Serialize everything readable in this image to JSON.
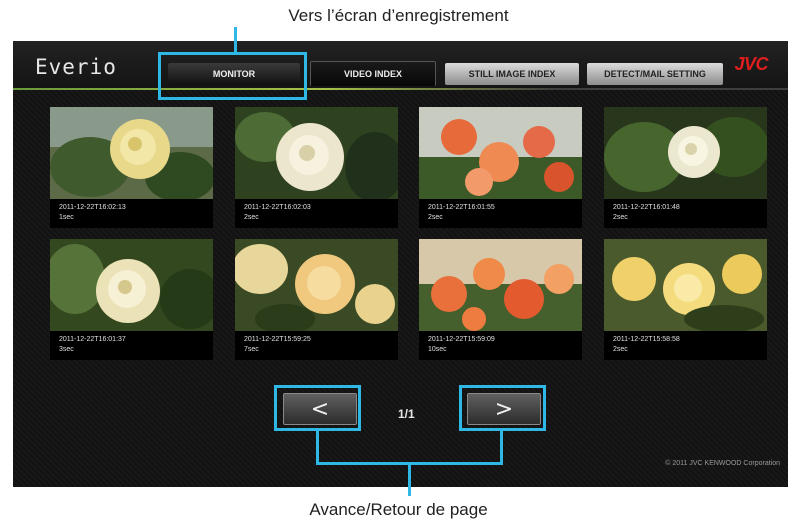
{
  "annotations": {
    "top": "Vers l’écran d’enregistrement",
    "bottom": "Avance/Retour de page"
  },
  "app": {
    "logo": "Everio",
    "brand": "JVC"
  },
  "tabs": [
    {
      "label": "MONITOR"
    },
    {
      "label": "VIDEO INDEX"
    },
    {
      "label": "STILL IMAGE INDEX"
    },
    {
      "label": "DETECT/MAIL SETTING"
    }
  ],
  "videos": [
    {
      "timestamp": "2011-12-22T16:02:13",
      "duration": "1sec"
    },
    {
      "timestamp": "2011-12-22T16:02:03",
      "duration": "2sec"
    },
    {
      "timestamp": "2011-12-22T16:01:55",
      "duration": "2sec"
    },
    {
      "timestamp": "2011-12-22T16:01:48",
      "duration": "2sec"
    },
    {
      "timestamp": "2011-12-22T16:01:37",
      "duration": "3sec"
    },
    {
      "timestamp": "2011-12-22T15:59:25",
      "duration": "7sec"
    },
    {
      "timestamp": "2011-12-22T15:59:09",
      "duration": "10sec"
    },
    {
      "timestamp": "2011-12-22T15:58:58",
      "duration": "2sec"
    }
  ],
  "pagination": {
    "prev_label": "<",
    "next_label": ">",
    "indicator": "1/1"
  },
  "footer": {
    "copyright": "© 2011 JVC KENWOOD Corporation"
  },
  "colors": {
    "highlight": "#2eb8e6",
    "brand": "#e01e1e",
    "accent_line": "#a6c24a"
  },
  "icons": {
    "prev": "chevron-left-icon",
    "next": "chevron-right-icon"
  }
}
